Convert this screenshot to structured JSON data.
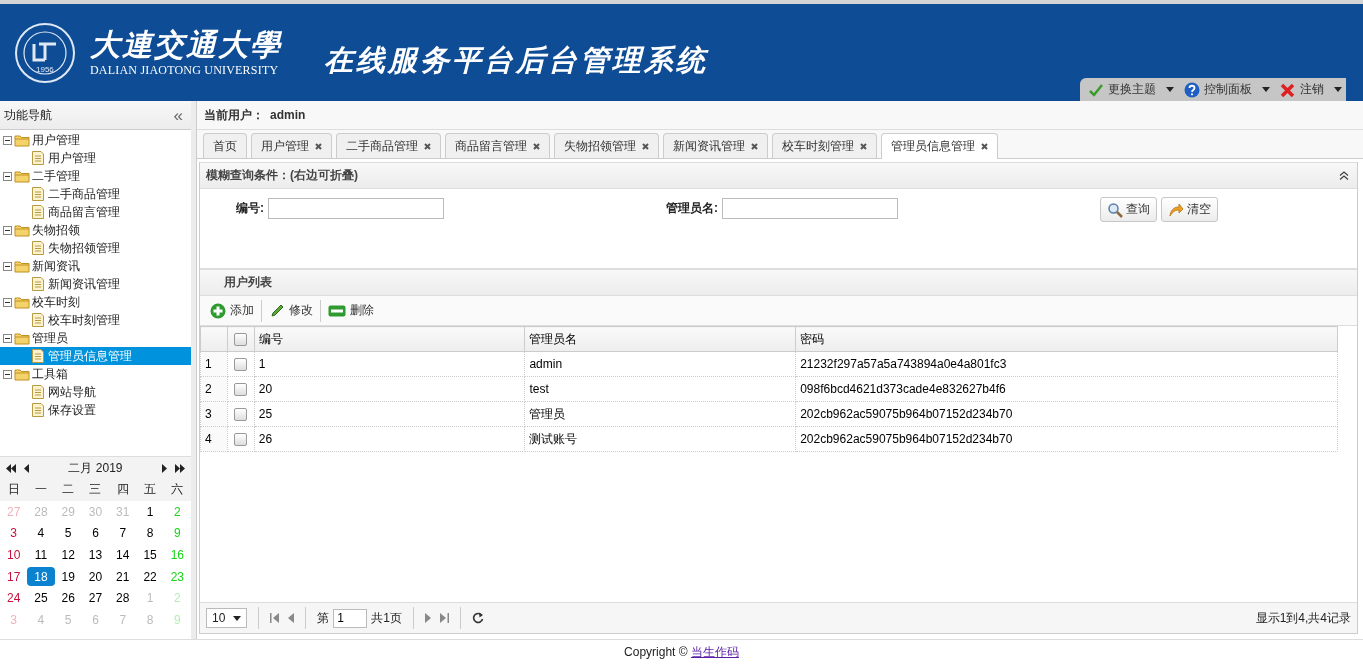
{
  "header": {
    "university_cn": "大連交通大學",
    "university_en": "DALIAN JIAOTONG UNIVERSITY",
    "logo_year": "1956",
    "system_title": "在线服务平台后台管理系统",
    "menus": [
      {
        "label": "更换主题"
      },
      {
        "label": "控制面板"
      },
      {
        "label": "注销"
      }
    ]
  },
  "sidebar": {
    "title": "功能导航",
    "collapse": "«",
    "tree": [
      {
        "label": "用户管理",
        "expanded": true,
        "children": [
          {
            "label": "用户管理",
            "selected": false
          }
        ]
      },
      {
        "label": "二手管理",
        "expanded": true,
        "children": [
          {
            "label": "二手商品管理",
            "selected": false
          },
          {
            "label": "商品留言管理",
            "selected": false
          }
        ]
      },
      {
        "label": "失物招领",
        "expanded": true,
        "children": [
          {
            "label": "失物招领管理",
            "selected": false
          }
        ]
      },
      {
        "label": "新闻资讯",
        "expanded": true,
        "children": [
          {
            "label": "新闻资讯管理",
            "selected": false
          }
        ]
      },
      {
        "label": "校车时刻",
        "expanded": true,
        "children": [
          {
            "label": "校车时刻管理",
            "selected": false
          }
        ]
      },
      {
        "label": "管理员",
        "expanded": true,
        "children": [
          {
            "label": "管理员信息管理",
            "selected": true
          }
        ]
      },
      {
        "label": "工具箱",
        "expanded": true,
        "children": [
          {
            "label": "网站导航",
            "selected": false
          },
          {
            "label": "保存设置",
            "selected": false
          }
        ]
      }
    ]
  },
  "calendar": {
    "month": "二月 2019",
    "weekdays": [
      "日",
      "一",
      "二",
      "三",
      "四",
      "五",
      "六"
    ],
    "weeks": [
      [
        {
          "d": "27",
          "muted": true,
          "selected": false
        },
        {
          "d": "28",
          "muted": true,
          "selected": false
        },
        {
          "d": "29",
          "muted": true,
          "selected": false
        },
        {
          "d": "30",
          "muted": true,
          "selected": false
        },
        {
          "d": "31",
          "muted": true,
          "selected": false
        },
        {
          "d": "1",
          "muted": false,
          "selected": false
        },
        {
          "d": "2",
          "muted": false,
          "selected": false
        }
      ],
      [
        {
          "d": "3",
          "muted": false,
          "selected": false
        },
        {
          "d": "4",
          "muted": false,
          "selected": false
        },
        {
          "d": "5",
          "muted": false,
          "selected": false
        },
        {
          "d": "6",
          "muted": false,
          "selected": false
        },
        {
          "d": "7",
          "muted": false,
          "selected": false
        },
        {
          "d": "8",
          "muted": false,
          "selected": false
        },
        {
          "d": "9",
          "muted": false,
          "selected": false
        }
      ],
      [
        {
          "d": "10",
          "muted": false,
          "selected": false
        },
        {
          "d": "11",
          "muted": false,
          "selected": false
        },
        {
          "d": "12",
          "muted": false,
          "selected": false
        },
        {
          "d": "13",
          "muted": false,
          "selected": false
        },
        {
          "d": "14",
          "muted": false,
          "selected": false
        },
        {
          "d": "15",
          "muted": false,
          "selected": false
        },
        {
          "d": "16",
          "muted": false,
          "selected": false
        }
      ],
      [
        {
          "d": "17",
          "muted": false,
          "selected": false
        },
        {
          "d": "18",
          "muted": false,
          "selected": true
        },
        {
          "d": "19",
          "muted": false,
          "selected": false
        },
        {
          "d": "20",
          "muted": false,
          "selected": false
        },
        {
          "d": "21",
          "muted": false,
          "selected": false
        },
        {
          "d": "22",
          "muted": false,
          "selected": false
        },
        {
          "d": "23",
          "muted": false,
          "selected": false
        }
      ],
      [
        {
          "d": "24",
          "muted": false,
          "selected": false
        },
        {
          "d": "25",
          "muted": false,
          "selected": false
        },
        {
          "d": "26",
          "muted": false,
          "selected": false
        },
        {
          "d": "27",
          "muted": false,
          "selected": false
        },
        {
          "d": "28",
          "muted": false,
          "selected": false
        },
        {
          "d": "1",
          "muted": true,
          "selected": false
        },
        {
          "d": "2",
          "muted": true,
          "selected": false
        }
      ],
      [
        {
          "d": "3",
          "muted": true,
          "selected": false
        },
        {
          "d": "4",
          "muted": true,
          "selected": false
        },
        {
          "d": "5",
          "muted": true,
          "selected": false
        },
        {
          "d": "6",
          "muted": true,
          "selected": false
        },
        {
          "d": "7",
          "muted": true,
          "selected": false
        },
        {
          "d": "8",
          "muted": true,
          "selected": false
        },
        {
          "d": "9",
          "muted": true,
          "selected": false
        }
      ]
    ]
  },
  "current_user": {
    "label": "当前用户：",
    "value": "admin"
  },
  "tabs": [
    {
      "label": "首页",
      "closable": false,
      "selected": false
    },
    {
      "label": "用户管理",
      "closable": true,
      "selected": false
    },
    {
      "label": "二手商品管理",
      "closable": true,
      "selected": false
    },
    {
      "label": "商品留言管理",
      "closable": true,
      "selected": false
    },
    {
      "label": "失物招领管理",
      "closable": true,
      "selected": false
    },
    {
      "label": "新闻资讯管理",
      "closable": true,
      "selected": false
    },
    {
      "label": "校车时刻管理",
      "closable": true,
      "selected": false
    },
    {
      "label": "管理员信息管理",
      "closable": true,
      "selected": true
    }
  ],
  "query": {
    "title": "模糊查询条件：(右边可折叠)",
    "fields": [
      {
        "label": "编号:"
      },
      {
        "label": "管理员名:"
      }
    ],
    "buttons": [
      {
        "label": "查询"
      },
      {
        "label": "清空"
      }
    ]
  },
  "list": {
    "title": "用户列表",
    "actions": [
      {
        "label": "添加"
      },
      {
        "label": "修改"
      },
      {
        "label": "删除"
      }
    ],
    "all_checked": false,
    "columns": [
      "编号",
      "管理员名",
      "密码"
    ],
    "rows": [
      {
        "num": "1",
        "checked": false,
        "cells": [
          "1",
          "admin",
          "21232f297a57a5a743894a0e4a801fc3"
        ]
      },
      {
        "num": "2",
        "checked": false,
        "cells": [
          "20",
          "test",
          "098f6bcd4621d373cade4e832627b4f6"
        ]
      },
      {
        "num": "3",
        "checked": false,
        "cells": [
          "25",
          "管理员",
          "202cb962ac59075b964b07152d234b70"
        ]
      },
      {
        "num": "4",
        "checked": false,
        "cells": [
          "26",
          "测试账号",
          "202cb962ac59075b964b07152d234b70"
        ]
      }
    ]
  },
  "pagination": {
    "page_size": "10",
    "page_prefix": "第",
    "page": "1",
    "page_suffix": "共1页",
    "summary": "显示1到4,共4记录"
  },
  "footer": {
    "text": "Copyright © ",
    "link": "当生作码"
  }
}
